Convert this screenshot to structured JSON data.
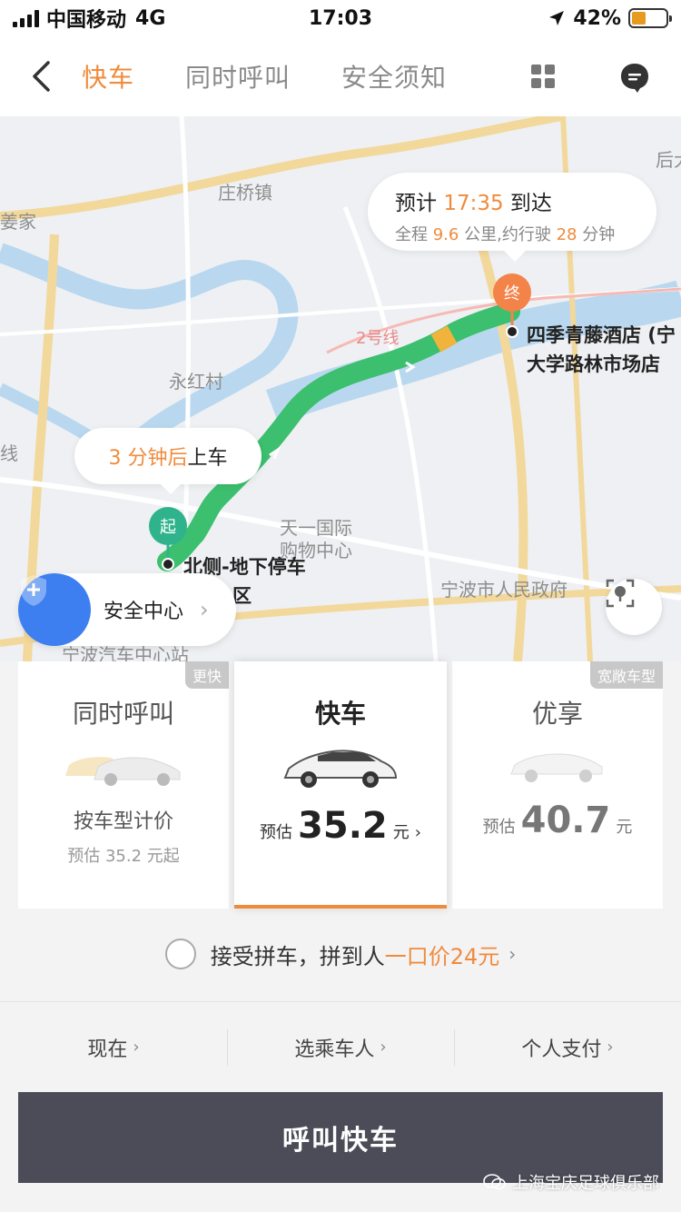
{
  "status_bar": {
    "carrier": "中国移动",
    "network": "4G",
    "time": "17:03",
    "battery": "42%",
    "battery_level": 0.42
  },
  "nav": {
    "tabs": [
      {
        "label": "快车",
        "active": true
      },
      {
        "label": "同时呼叫",
        "active": false
      },
      {
        "label": "安全须知",
        "active": false
      }
    ],
    "icons": [
      "back-chevron-icon",
      "grid-icon",
      "message-icon"
    ]
  },
  "map": {
    "eta": {
      "prefix": "预计",
      "time": "17:35",
      "suffix": "到达",
      "dist_prefix": "全程",
      "distance": "9.6",
      "dist_mid": "公里,约行驶",
      "minutes": "28",
      "dist_suffix": "分钟"
    },
    "pickup": {
      "minutes": "3 分钟后",
      "text": "上车"
    },
    "start_pin": "起",
    "end_pin": "终",
    "start_place": "北侧-地下停车",
    "start_place2": "区",
    "end_place_1": "四季青藤酒店 (宁",
    "end_place_2": "大学路林市场店",
    "labels": {
      "zhuangqiao": "庄桥镇",
      "jiangjia": "姜家",
      "yonghong": "永红村",
      "line2": "2号线",
      "tianyi_1": "天一国际",
      "tianyi_2": "购物中心",
      "gov": "宁波市人民政府",
      "bus": "宁波汽车中心站",
      "houda": "后大",
      "line": "线"
    },
    "safety_center": "安全中心"
  },
  "cards": [
    {
      "tag": "更快",
      "title": "同时呼叫",
      "sub": "按车型计价",
      "sub2": "预估 35.2 元起"
    },
    {
      "tag": "",
      "title": "快车",
      "price_prefix": "预估",
      "price": "35.2",
      "price_unit": "元",
      "chevron": "›"
    },
    {
      "tag": "宽敞车型",
      "title": "优享",
      "price_prefix": "预估",
      "price": "40.7",
      "price_unit": "元"
    }
  ],
  "carpool": {
    "text": "接受拼车，拼到人",
    "highlight": "一口价24元",
    "checked": false
  },
  "options": [
    {
      "label": "现在"
    },
    {
      "label": "选乘车人"
    },
    {
      "label": "个人支付"
    }
  ],
  "call_button": "呼叫快车",
  "watermark": "上海宝庆足球俱乐部",
  "colors": {
    "accent": "#f08b3c",
    "route": "#3cbf6e",
    "call_bg": "#4b4c58",
    "start_pin": "#2fb38c",
    "end_pin": "#f4834a"
  }
}
